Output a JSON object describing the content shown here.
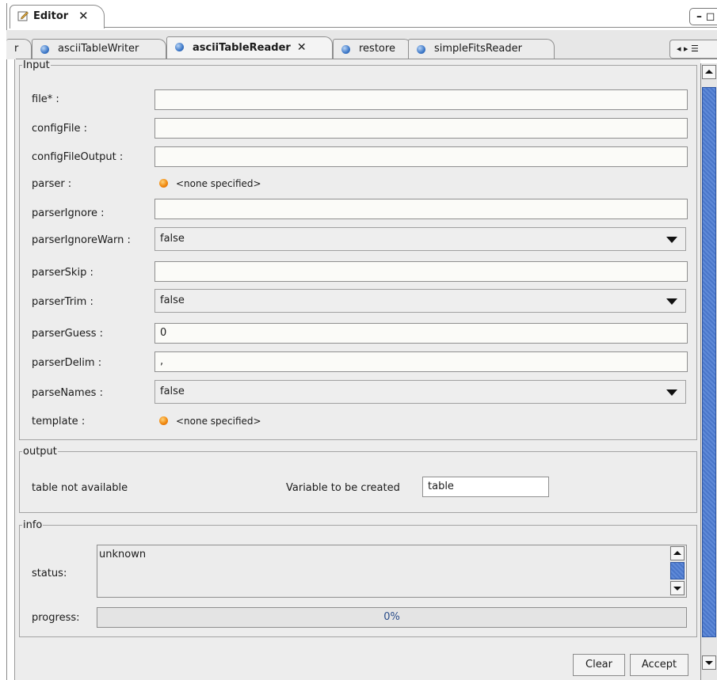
{
  "view_tab": {
    "title": "Editor",
    "close": "✕"
  },
  "window_controls": {
    "glyph": "– ◻"
  },
  "doc_tabs": [
    {
      "label": "r",
      "partial": true
    },
    {
      "label": "asciiTableWriter"
    },
    {
      "label": "asciiTableReader",
      "active": true,
      "close": "✕"
    },
    {
      "label": "restore"
    },
    {
      "label": "simpleFitsReader"
    }
  ],
  "tab_nav": {
    "glyph": "◂ ▸ ☰"
  },
  "input_group": {
    "title": "Input",
    "rows": [
      {
        "label": "file* :",
        "kind": "text",
        "value": ""
      },
      {
        "label": "configFile :",
        "kind": "text",
        "value": ""
      },
      {
        "label": "configFileOutput :",
        "kind": "text",
        "value": ""
      },
      {
        "label": "parser :",
        "kind": "none",
        "value": "<none specified>"
      },
      {
        "label": "parserIgnore :",
        "kind": "text",
        "value": ""
      },
      {
        "label": "parserIgnoreWarn :",
        "kind": "combo",
        "value": "false"
      },
      {
        "label": "parserSkip :",
        "kind": "text",
        "value": ""
      },
      {
        "label": "parserTrim :",
        "kind": "combo",
        "value": "false"
      },
      {
        "label": "parserGuess :",
        "kind": "text",
        "value": "0"
      },
      {
        "label": "parserDelim :",
        "kind": "text",
        "value": ","
      },
      {
        "label": "parseNames :",
        "kind": "combo",
        "value": "false"
      },
      {
        "label": "template :",
        "kind": "none",
        "value": "<none specified>"
      }
    ]
  },
  "output_group": {
    "title": "output",
    "status_text": "table  not available",
    "variable_label": "Variable to be created",
    "variable_value": "table"
  },
  "info_group": {
    "title": "info",
    "status_label": "status:",
    "status_value": "unknown",
    "progress_label": "progress:",
    "progress_value": "0%"
  },
  "buttons": {
    "clear": "Clear",
    "accept": "Accept"
  },
  "colors": {
    "accent": "#4a76c9",
    "panel": "#ededed",
    "input_bg": "#fbfbf8",
    "dot_blue": "#3d78c8",
    "dot_orange": "#f08a10"
  },
  "icons": {
    "view_tab_icon": "pencil-note-icon",
    "tab_icon": "blue-dot-icon",
    "unset_icon": "orange-dot-icon"
  }
}
